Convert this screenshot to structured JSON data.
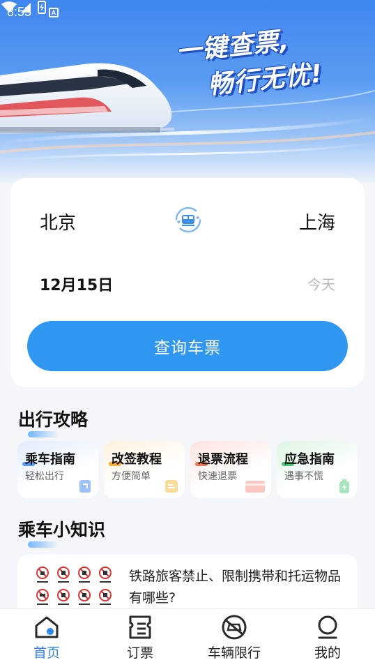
{
  "status_bar": {
    "time": "8:55",
    "badge": "A"
  },
  "banner": {
    "slogan_line1": "一键查票,",
    "slogan_line2": "畅行无忧!"
  },
  "search": {
    "from_city": "北京",
    "to_city": "上海",
    "date": "12月15日",
    "day_label": "今天",
    "button_label": "查询车票"
  },
  "travel_guide": {
    "title": "出行攻略",
    "items": [
      {
        "title": "乘车指南",
        "subtitle": "轻松出行",
        "accent": "#4a8ef0"
      },
      {
        "title": "改签教程",
        "subtitle": "方便简单",
        "accent": "#f5a623"
      },
      {
        "title": "退票流程",
        "subtitle": "快速退票",
        "accent": "#f06a4a"
      },
      {
        "title": "应急指南",
        "subtitle": "遇事不慌",
        "accent": "#39c26a"
      }
    ]
  },
  "knowledge": {
    "title": "乘车小知识",
    "article_title": "铁路旅客禁止、限制携带和托运物品有哪些?"
  },
  "bottom_nav": {
    "items": [
      {
        "label": "首页",
        "icon": "home-icon",
        "active": true
      },
      {
        "label": "订票",
        "icon": "ticket-icon",
        "active": false
      },
      {
        "label": "车辆限行",
        "icon": "car-restriction-icon",
        "active": false
      },
      {
        "label": "我的",
        "icon": "profile-icon",
        "active": false
      }
    ]
  },
  "colors": {
    "primary": "#2f97f0",
    "active_nav": "#2f86e8"
  }
}
